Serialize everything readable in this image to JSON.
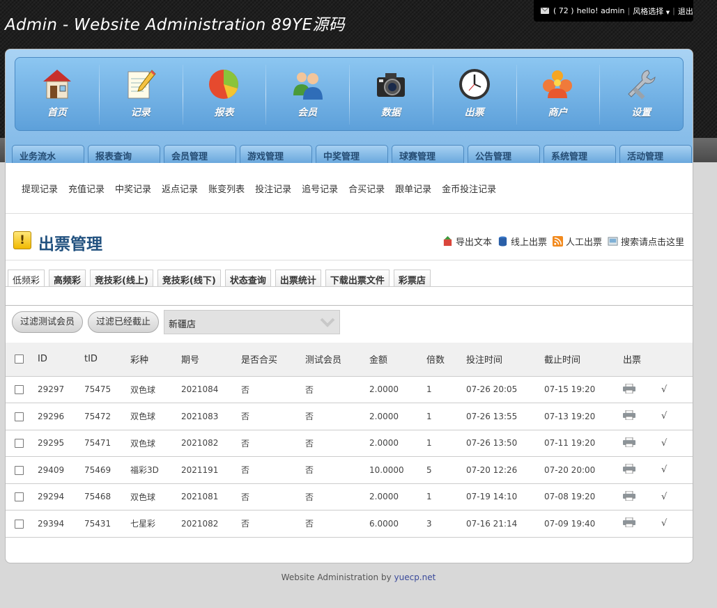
{
  "header": {
    "site_title": "Admin - Website Administration 89YE源码",
    "message_count": "( 72 )",
    "greeting": "hello! admin",
    "style_select": "风格选择",
    "logout": "退出"
  },
  "nav": {
    "items": [
      {
        "label": "首页",
        "icon": "home-icon"
      },
      {
        "label": "记录",
        "icon": "notepad-icon"
      },
      {
        "label": "报表",
        "icon": "pie-chart-icon"
      },
      {
        "label": "会员",
        "icon": "users-icon"
      },
      {
        "label": "数据",
        "icon": "camera-icon"
      },
      {
        "label": "出票",
        "icon": "clock-icon"
      },
      {
        "label": "商户",
        "icon": "merchant-icon"
      },
      {
        "label": "设置",
        "icon": "tools-icon"
      }
    ]
  },
  "tabs": [
    "业务流水",
    "报表查询",
    "会员管理",
    "游戏管理",
    "中奖管理",
    "球赛管理",
    "公告管理",
    "系统管理",
    "活动管理"
  ],
  "sublinks": [
    "提现记录",
    "充值记录",
    "中奖记录",
    "返点记录",
    "账变列表",
    "投注记录",
    "追号记录",
    "合买记录",
    "跟单记录",
    "金币投注记录"
  ],
  "section": {
    "title": "出票管理",
    "actions": [
      {
        "label": "导出文本",
        "icon": "export-icon"
      },
      {
        "label": "线上出票",
        "icon": "database-icon"
      },
      {
        "label": "人工出票",
        "icon": "rss-icon"
      },
      {
        "label": "搜索请点击这里",
        "icon": "search-icon"
      }
    ]
  },
  "subtabs": [
    "低频彩",
    "高频彩",
    "竞技彩(线上)",
    "竞技彩(线下)",
    "状态查询",
    "出票统计",
    "下载出票文件",
    "彩票店"
  ],
  "filters": {
    "filter_test": "过滤测试会员",
    "filter_closed": "过滤已经截止",
    "store_select": "新疆店"
  },
  "table": {
    "columns": [
      "ID",
      "tID",
      "彩种",
      "期号",
      "是否合买",
      "测试会员",
      "金额",
      "倍数",
      "投注时间",
      "截止时间",
      "出票"
    ],
    "rows": [
      {
        "id": "29297",
        "tid": "75475",
        "type": "双色球",
        "period": "2021084",
        "joint": "否",
        "test": "否",
        "amount": "2.0000",
        "multiple": "1",
        "bet_time": "07-26 20:05",
        "deadline": "07-15 19:20",
        "mark": "√"
      },
      {
        "id": "29296",
        "tid": "75472",
        "type": "双色球",
        "period": "2021083",
        "joint": "否",
        "test": "否",
        "amount": "2.0000",
        "multiple": "1",
        "bet_time": "07-26 13:55",
        "deadline": "07-13 19:20",
        "mark": "√"
      },
      {
        "id": "29295",
        "tid": "75471",
        "type": "双色球",
        "period": "2021082",
        "joint": "否",
        "test": "否",
        "amount": "2.0000",
        "multiple": "1",
        "bet_time": "07-26 13:50",
        "deadline": "07-11 19:20",
        "mark": "√"
      },
      {
        "id": "29409",
        "tid": "75469",
        "type": "福彩3D",
        "period": "2021191",
        "joint": "否",
        "test": "否",
        "amount": "10.0000",
        "multiple": "5",
        "bet_time": "07-20 12:26",
        "deadline": "07-20 20:00",
        "mark": "√"
      },
      {
        "id": "29294",
        "tid": "75468",
        "type": "双色球",
        "period": "2021081",
        "joint": "否",
        "test": "否",
        "amount": "2.0000",
        "multiple": "1",
        "bet_time": "07-19 14:10",
        "deadline": "07-08 19:20",
        "mark": "√"
      },
      {
        "id": "29394",
        "tid": "75431",
        "type": "七星彩",
        "period": "2021082",
        "joint": "否",
        "test": "否",
        "amount": "6.0000",
        "multiple": "3",
        "bet_time": "07-16 21:14",
        "deadline": "07-09 19:40",
        "mark": "√"
      }
    ]
  },
  "footer": {
    "text": "Website Administration by",
    "link": "yuecp.net"
  }
}
